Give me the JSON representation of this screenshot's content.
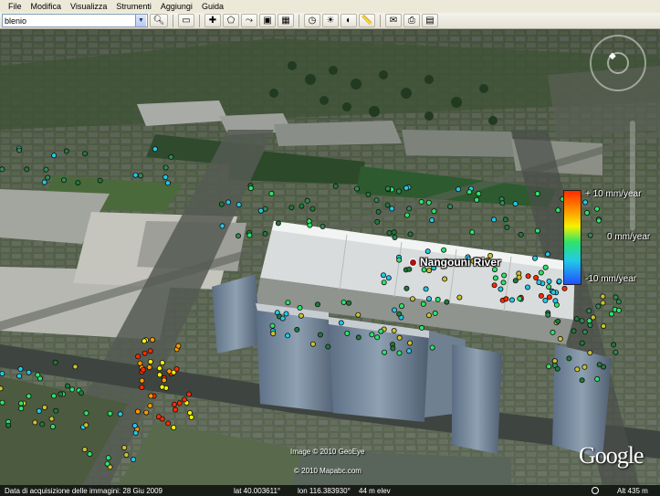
{
  "menu": [
    "File",
    "Modifica",
    "Visualizza",
    "Strumenti",
    "Aggiungi",
    "Guida"
  ],
  "search": {
    "value": "blenio",
    "dropdown_icon": "chevron-down-icon",
    "button_icon": "search-icon"
  },
  "toolbar": {
    "buttons": [
      {
        "name": "sidebar-toggle-button",
        "icon": "sidebar-icon",
        "glyph": "▭"
      },
      {
        "name": "add-placemark-button",
        "icon": "pushpin-icon",
        "glyph": "✚"
      },
      {
        "name": "add-polygon-button",
        "icon": "polygon-icon",
        "glyph": "⬠"
      },
      {
        "name": "add-path-button",
        "icon": "path-icon",
        "glyph": "⤳"
      },
      {
        "name": "add-overlay-button",
        "icon": "image-overlay-icon",
        "glyph": "▣"
      },
      {
        "name": "record-tour-button",
        "icon": "record-icon",
        "glyph": "▦"
      },
      {
        "name": "historical-imagery-button",
        "icon": "clock-icon",
        "glyph": "◷"
      },
      {
        "name": "sunlight-button",
        "icon": "sun-icon",
        "glyph": "☀"
      },
      {
        "name": "switch-planet-button",
        "icon": "planet-icon",
        "glyph": "◐"
      },
      {
        "name": "ruler-button",
        "icon": "ruler-icon",
        "glyph": "📏"
      },
      {
        "name": "email-button",
        "icon": "email-icon",
        "glyph": "✉"
      },
      {
        "name": "print-button",
        "icon": "print-icon",
        "glyph": "⎙"
      },
      {
        "name": "maps-button",
        "icon": "map-icon",
        "glyph": "▤"
      }
    ]
  },
  "place_label": "Nangouni River",
  "legend": {
    "top": "10 mm/year",
    "mid": "0 mm/year",
    "bottom": "-10 mm/year",
    "top_prefix": "+",
    "colors": [
      "#ff2b00",
      "#ff9a00",
      "#f4f200",
      "#2ee36a",
      "#23c9e8",
      "#2050ff"
    ]
  },
  "copyright": {
    "line1": "Image © 2010 GeoEye",
    "line2": "© 2010 Mapabc.com"
  },
  "logo": "Google",
  "status": {
    "date": "Data di acquisizione delle immagini: 28 Giu 2009",
    "lat": "lat   40.003611°",
    "lon": "lon   116.383930°",
    "elev": "44 m elev",
    "alt": "Alt  435 m"
  }
}
